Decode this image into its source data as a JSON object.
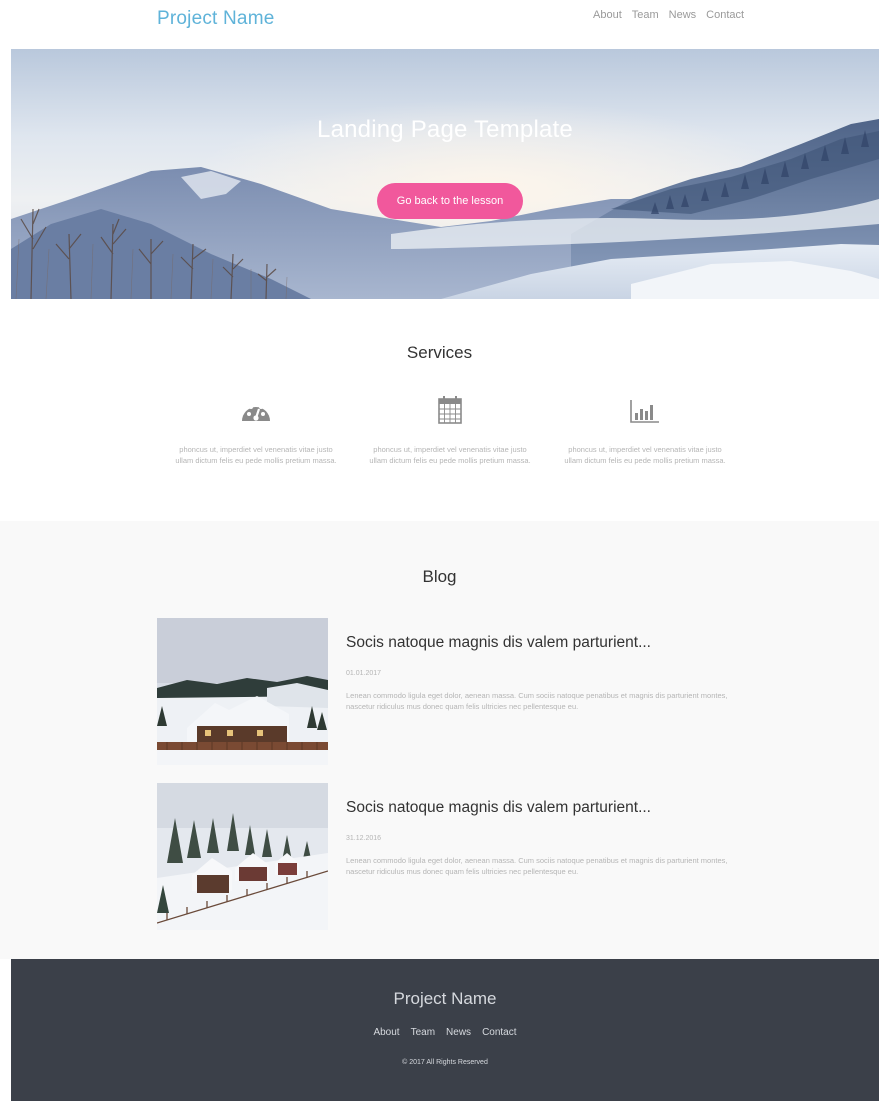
{
  "header": {
    "brand": "Project Name",
    "nav": [
      "About",
      "Team",
      "News",
      "Contact"
    ]
  },
  "hero": {
    "title": "Landing Page Template",
    "button": "Go back to the lesson"
  },
  "services": {
    "title": "Services",
    "items": [
      {
        "icon": "dashboard-icon",
        "text": "phoncus ut, imperdiet vel venenatis vitae justo ullam dictum felis eu pede mollis pretium massa."
      },
      {
        "icon": "calendar-icon",
        "text": "phoncus ut, imperdiet vel venenatis vitae justo ullam dictum felis eu pede mollis pretium massa."
      },
      {
        "icon": "bar-chart-icon",
        "text": "phoncus ut, imperdiet vel venenatis vitae justo ullam dictum felis eu pede mollis pretium massa."
      }
    ]
  },
  "blog": {
    "title": "Blog",
    "posts": [
      {
        "title": "Socis natoque magnis dis valem parturient...",
        "date": "01.01.2017",
        "text": "Lenean commodo ligula eget dolor, aenean massa. Cum sociis natoque penatibus et magnis dis parturient montes, nascetur ridiculus mus donec quam felis ultricies nec pellentesque eu."
      },
      {
        "title": "Socis natoque magnis dis valem parturient...",
        "date": "31.12.2016",
        "text": "Lenean commodo ligula eget dolor, aenean massa. Cum sociis natoque penatibus et magnis dis parturient montes, nascetur ridiculus mus donec quam felis ultricies nec pellentesque eu."
      }
    ]
  },
  "footer": {
    "brand": "Project Name",
    "nav": [
      "About",
      "Team",
      "News",
      "Contact"
    ],
    "copyright": "© 2017 All Rights Reserved"
  },
  "colors": {
    "brand": "#5fb3d9",
    "button": "#f1589c",
    "footer_bg": "#3b4049",
    "blog_bg": "#f9f9f9"
  }
}
